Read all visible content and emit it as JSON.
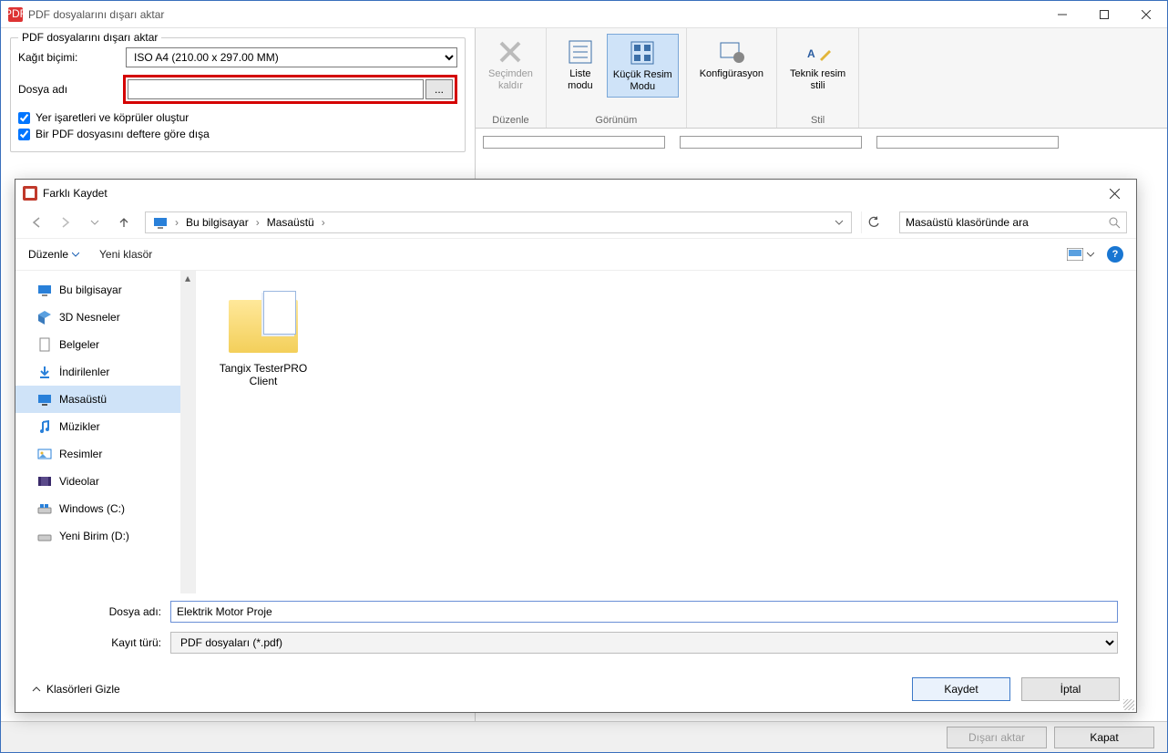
{
  "main": {
    "title": "PDF dosyalarını dışarı aktar",
    "group_title": "PDF dosyalarını dışarı aktar",
    "paper_label": "Kağıt biçimi:",
    "paper_value": "ISO A4 (210.00 x 297.00 MM)",
    "file_label": "Dosya adı",
    "file_value": "",
    "browse": "...",
    "check1": "Yer işaretleri ve köprüler oluştur",
    "check2": "Bir PDF dosyasını deftere göre dışa"
  },
  "ribbon": {
    "remove": "Seçimden\nkaldır",
    "edit_grp": "Düzenle",
    "list": "Liste\nmodu",
    "thumb": "Küçük Resim\nModu",
    "view_grp": "Görünüm",
    "config": "Konfigürasyon",
    "style": "Teknik resim\nstili",
    "style_grp": "Stil"
  },
  "bottom": {
    "export": "Dışarı aktar",
    "close": "Kapat"
  },
  "saveas": {
    "title": "Farklı Kaydet",
    "loc1": "Bu bilgisayar",
    "loc2": "Masaüstü",
    "search_ph": "Masaüstü klasöründe ara",
    "organize": "Düzenle",
    "newfolder": "Yeni klasör",
    "tree": {
      "pc": "Bu bilgisayar",
      "obj3d": "3D Nesneler",
      "docs": "Belgeler",
      "dl": "İndirilenler",
      "desk": "Masaüstü",
      "music": "Müzikler",
      "pics": "Resimler",
      "vids": "Videolar",
      "winc": "Windows  (C:)",
      "newvol": "Yeni Birim (D:)"
    },
    "folder_name": "Tangix TesterPRO Client",
    "fname_label": "Dosya adı:",
    "fname_value": "Elektrik Motor Proje",
    "type_label": "Kayıt türü:",
    "type_value": "PDF dosyaları (*.pdf)",
    "hide": "Klasörleri Gizle",
    "save": "Kaydet",
    "cancel": "İptal"
  }
}
